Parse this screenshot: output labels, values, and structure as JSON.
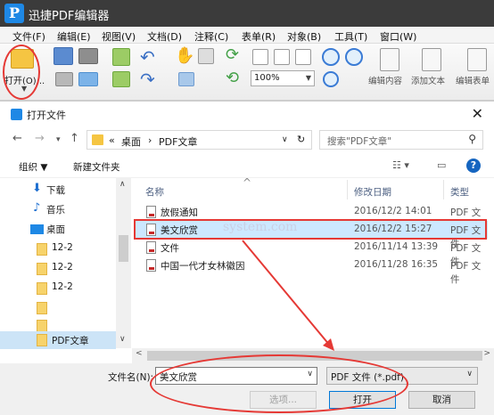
{
  "app": {
    "title": "迅捷PDF编辑器",
    "logo_letter": "P"
  },
  "menu": [
    "文件(F)",
    "编辑(E)",
    "视图(V)",
    "文档(D)",
    "注释(C)",
    "表单(R)",
    "对象(B)",
    "工具(T)",
    "窗口(W)"
  ],
  "toolbar": {
    "open_label": "打开(O)...",
    "zoom": "100%",
    "edit_content": "编辑内容",
    "add_text": "添加文本",
    "edit_form": "编辑表单"
  },
  "dialog": {
    "title": "打开文件",
    "close": "✕",
    "breadcrumb": {
      "prefix": "«",
      "parent": "桌面",
      "sep": "›",
      "current": "PDF文章"
    },
    "search_placeholder": "搜索\"PDF文章\"",
    "organize": "组织 ▼",
    "new_folder": "新建文件夹",
    "nav_items": [
      {
        "label": "下载"
      },
      {
        "label": "音乐"
      },
      {
        "label": "桌面"
      },
      {
        "label": "12-2"
      },
      {
        "label": "12-2"
      },
      {
        "label": "12-2"
      },
      {
        "label": ""
      },
      {
        "label": ""
      },
      {
        "label": "PDF文章"
      }
    ],
    "columns": {
      "name": "名称",
      "date": "修改日期",
      "type": "类型"
    },
    "files": [
      {
        "name": "放假通知",
        "date": "2016/12/2 14:01",
        "type": "PDF 文件"
      },
      {
        "name": "美文欣赏",
        "date": "2016/12/2 15:27",
        "type": "PDF 文件"
      },
      {
        "name": "文件",
        "date": "2016/11/14 13:39",
        "type": "PDF 文件"
      },
      {
        "name": "中国一代才女林徽因",
        "date": "2016/11/28 16:35",
        "type": "PDF 文件"
      }
    ],
    "watermark": "system.com",
    "filename_label": "文件名(N):",
    "filename_value": "美文欣赏",
    "filetype": "PDF 文件 (*.pdf)",
    "btn_options": "选项...",
    "btn_open": "打开",
    "btn_cancel": "取消"
  }
}
